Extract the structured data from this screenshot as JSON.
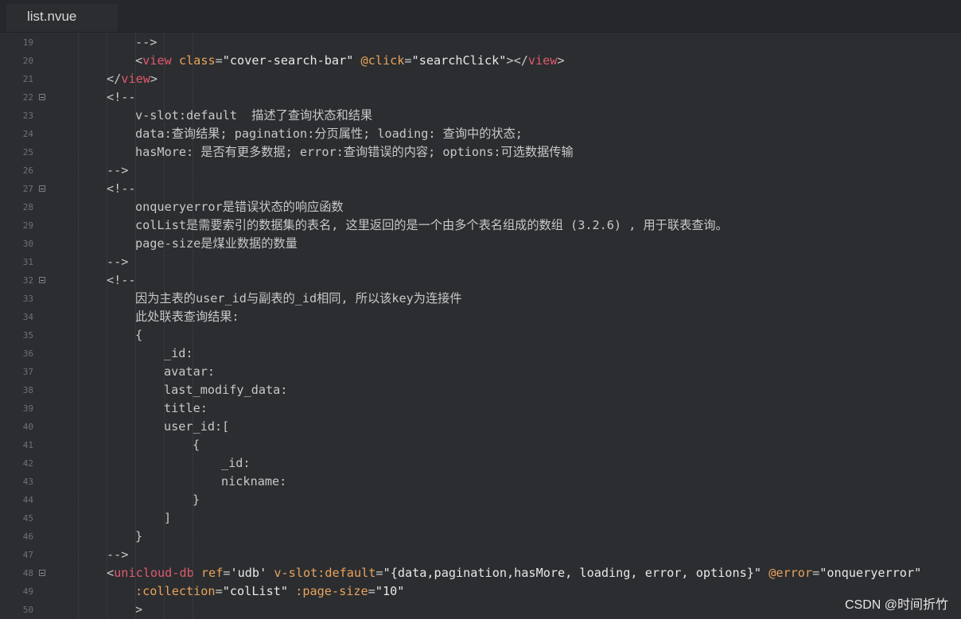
{
  "tab": {
    "label": "list.nvue"
  },
  "watermark": "CSDN @时间折竹",
  "lines": [
    {
      "n": "19",
      "indent": 2,
      "fold": false,
      "segs": [
        [
          "c-comment",
          "-->"
        ]
      ]
    },
    {
      "n": "20",
      "indent": 2,
      "fold": false,
      "segs": [
        [
          "c-punc",
          "<"
        ],
        [
          "c-tag",
          "view"
        ],
        [
          "c-punc",
          " "
        ],
        [
          "c-attr",
          "class"
        ],
        [
          "c-punc",
          "="
        ],
        [
          "c-str",
          "\"cover-search-bar\""
        ],
        [
          "c-punc",
          " "
        ],
        [
          "c-event",
          "@click"
        ],
        [
          "c-punc",
          "="
        ],
        [
          "c-str",
          "\"searchClick\""
        ],
        [
          "c-punc",
          "></"
        ],
        [
          "c-tag",
          "view"
        ],
        [
          "c-punc",
          ">"
        ]
      ]
    },
    {
      "n": "21",
      "indent": 1,
      "fold": false,
      "segs": [
        [
          "c-punc",
          "</"
        ],
        [
          "c-tag",
          "view"
        ],
        [
          "c-punc",
          ">"
        ]
      ]
    },
    {
      "n": "22",
      "indent": 1,
      "fold": true,
      "segs": [
        [
          "c-comment",
          "<!--"
        ]
      ]
    },
    {
      "n": "23",
      "indent": 2,
      "fold": false,
      "segs": [
        [
          "c-comment",
          "v-slot:default  描述了查询状态和结果"
        ]
      ]
    },
    {
      "n": "24",
      "indent": 2,
      "fold": false,
      "segs": [
        [
          "c-comment",
          "data:查询结果; pagination:分页属性; loading: 查询中的状态;"
        ]
      ]
    },
    {
      "n": "25",
      "indent": 2,
      "fold": false,
      "segs": [
        [
          "c-comment",
          "hasMore: 是否有更多数据; error:查询错误的内容; options:可选数据传输"
        ]
      ]
    },
    {
      "n": "26",
      "indent": 1,
      "fold": false,
      "segs": [
        [
          "c-comment",
          "-->"
        ]
      ]
    },
    {
      "n": "27",
      "indent": 1,
      "fold": true,
      "segs": [
        [
          "c-comment",
          "<!--"
        ]
      ]
    },
    {
      "n": "28",
      "indent": 2,
      "fold": false,
      "segs": [
        [
          "c-comment",
          "onqueryerror是错误状态的响应函数"
        ]
      ]
    },
    {
      "n": "29",
      "indent": 2,
      "fold": false,
      "segs": [
        [
          "c-comment",
          "colList是需要索引的数据集的表名, 这里返回的是一个由多个表名组成的数组 (3.2.6) , 用于联表查询。"
        ]
      ]
    },
    {
      "n": "30",
      "indent": 2,
      "fold": false,
      "segs": [
        [
          "c-comment",
          "page-size是煤业数据的数量"
        ]
      ]
    },
    {
      "n": "31",
      "indent": 1,
      "fold": false,
      "segs": [
        [
          "c-comment",
          "-->"
        ]
      ]
    },
    {
      "n": "32",
      "indent": 1,
      "fold": true,
      "segs": [
        [
          "c-comment",
          "<!--"
        ]
      ]
    },
    {
      "n": "33",
      "indent": 2,
      "fold": false,
      "segs": [
        [
          "c-comment",
          "因为主表的user_id与副表的_id相同, 所以该key为连接件"
        ]
      ]
    },
    {
      "n": "34",
      "indent": 2,
      "fold": false,
      "segs": [
        [
          "c-comment",
          "此处联表查询结果:"
        ]
      ]
    },
    {
      "n": "35",
      "indent": 2,
      "fold": false,
      "segs": [
        [
          "c-comment",
          "{"
        ]
      ]
    },
    {
      "n": "36",
      "indent": 3,
      "fold": false,
      "segs": [
        [
          "c-comment",
          "_id:"
        ]
      ]
    },
    {
      "n": "37",
      "indent": 3,
      "fold": false,
      "segs": [
        [
          "c-comment",
          "avatar:"
        ]
      ]
    },
    {
      "n": "38",
      "indent": 3,
      "fold": false,
      "segs": [
        [
          "c-comment",
          "last_modify_data:"
        ]
      ]
    },
    {
      "n": "39",
      "indent": 3,
      "fold": false,
      "segs": [
        [
          "c-comment",
          "title:"
        ]
      ]
    },
    {
      "n": "40",
      "indent": 3,
      "fold": false,
      "segs": [
        [
          "c-comment",
          "user_id:["
        ]
      ]
    },
    {
      "n": "41",
      "indent": 4,
      "fold": false,
      "segs": [
        [
          "c-comment",
          "{"
        ]
      ]
    },
    {
      "n": "42",
      "indent": 5,
      "fold": false,
      "segs": [
        [
          "c-comment",
          "_id:"
        ]
      ]
    },
    {
      "n": "43",
      "indent": 5,
      "fold": false,
      "segs": [
        [
          "c-comment",
          "nickname:"
        ]
      ]
    },
    {
      "n": "44",
      "indent": 4,
      "fold": false,
      "segs": [
        [
          "c-comment",
          "}"
        ]
      ]
    },
    {
      "n": "45",
      "indent": 3,
      "fold": false,
      "segs": [
        [
          "c-comment",
          "]"
        ]
      ]
    },
    {
      "n": "46",
      "indent": 2,
      "fold": false,
      "segs": [
        [
          "c-comment",
          "}"
        ]
      ]
    },
    {
      "n": "47",
      "indent": 1,
      "fold": false,
      "segs": [
        [
          "c-comment",
          "-->"
        ]
      ]
    },
    {
      "n": "48",
      "indent": 1,
      "fold": true,
      "segs": [
        [
          "c-punc",
          "<"
        ],
        [
          "c-tag",
          "unicloud-db"
        ],
        [
          "c-punc",
          " "
        ],
        [
          "c-attr",
          "ref"
        ],
        [
          "c-punc",
          "="
        ],
        [
          "c-str",
          "'udb'"
        ],
        [
          "c-punc",
          " "
        ],
        [
          "c-attr",
          "v-slot:default"
        ],
        [
          "c-punc",
          "="
        ],
        [
          "c-str",
          "\"{data,pagination,hasMore, loading, error, options}\""
        ],
        [
          "c-punc",
          " "
        ],
        [
          "c-event",
          "@error"
        ],
        [
          "c-punc",
          "="
        ],
        [
          "c-str",
          "\"onqueryerror\""
        ]
      ]
    },
    {
      "n": "49",
      "indent": 2,
      "fold": false,
      "segs": [
        [
          "c-attr",
          ":collection"
        ],
        [
          "c-punc",
          "="
        ],
        [
          "c-str",
          "\"colList\""
        ],
        [
          "c-punc",
          " "
        ],
        [
          "c-attr",
          ":page-size"
        ],
        [
          "c-punc",
          "="
        ],
        [
          "c-str",
          "\"10\""
        ]
      ]
    },
    {
      "n": "50",
      "indent": 2,
      "fold": false,
      "segs": [
        [
          "c-punc",
          ">"
        ]
      ]
    }
  ]
}
